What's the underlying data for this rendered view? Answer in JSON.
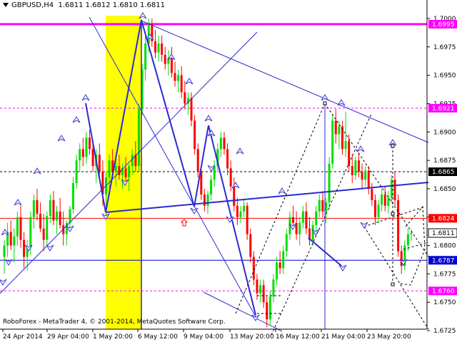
{
  "header": {
    "symbol": "GBPUSD",
    "timeframe": "H4",
    "ohlc": "1.6811 1.6812 1.6810 1.6811"
  },
  "footer": {
    "copyright": "RoboForex - MetaTrader 4, © 2001-2014, MetaQuotes Software Corp."
  },
  "colors": {
    "candle_up": "#00dd00",
    "candle_down": "#ff0000",
    "trend_line": "#2a2ad0",
    "level_magenta": "#ff00ff",
    "level_red": "#ff0000",
    "level_blue": "#0000cc",
    "level_black": "#000000",
    "highlight": "#ffff00",
    "wave_marker": "#3b3bcf",
    "signal_arrow": "#ff0000"
  },
  "chart_data": {
    "type": "candlestick",
    "symbol": "GBPUSD",
    "timeframe": "H4",
    "ylim": [
      1.6715,
      1.7005
    ],
    "y_ticks": [
      "1.7000",
      "1.6975",
      "1.6950",
      "1.6925",
      "1.6900",
      "1.6875",
      "1.6850",
      "1.6825",
      "1.6800",
      "1.6775",
      "1.6750",
      "1.6725"
    ],
    "x_ticks": [
      "24 Apr 2014",
      "29 Apr 04:00",
      "1 May 20:00",
      "6 May 12:00",
      "9 May 04:00",
      "13 May 20:00",
      "16 May 12:00",
      "21 May 04:00",
      "23 May 20:00"
    ],
    "levels": [
      {
        "value": 1.6995,
        "label": "1.6995",
        "color": "#ff00ff",
        "style": "solid"
      },
      {
        "value": 1.6921,
        "label": "1.6921",
        "color": "#ff00ff",
        "style": "dashed"
      },
      {
        "value": 1.6865,
        "label": "1.6865",
        "color": "#000000",
        "style": "dashed"
      },
      {
        "value": 1.6824,
        "label": "1.6824",
        "color": "#ff0000",
        "style": "solid"
      },
      {
        "value": 1.6787,
        "label": "1.6787",
        "color": "#0000cc",
        "style": "solid"
      },
      {
        "value": 1.676,
        "label": "1.6760",
        "color": "#ff00ff",
        "style": "dashed"
      }
    ],
    "current_price": {
      "value": 1.6811,
      "label": "1.6811"
    },
    "candles": [
      {
        "o": 1.679,
        "h": 1.6805,
        "l": 1.6775,
        "c": 1.68
      },
      {
        "o": 1.68,
        "h": 1.682,
        "l": 1.679,
        "c": 1.6812
      },
      {
        "o": 1.6812,
        "h": 1.6822,
        "l": 1.6796,
        "c": 1.68
      },
      {
        "o": 1.68,
        "h": 1.6815,
        "l": 1.6785,
        "c": 1.6808
      },
      {
        "o": 1.6808,
        "h": 1.683,
        "l": 1.68,
        "c": 1.6825
      },
      {
        "o": 1.6825,
        "h": 1.6835,
        "l": 1.6798,
        "c": 1.6805
      },
      {
        "o": 1.6805,
        "h": 1.6812,
        "l": 1.678,
        "c": 1.679
      },
      {
        "o": 1.679,
        "h": 1.6805,
        "l": 1.6778,
        "c": 1.6798
      },
      {
        "o": 1.6798,
        "h": 1.683,
        "l": 1.6792,
        "c": 1.6825
      },
      {
        "o": 1.6825,
        "h": 1.6845,
        "l": 1.6815,
        "c": 1.684
      },
      {
        "o": 1.684,
        "h": 1.685,
        "l": 1.6822,
        "c": 1.6828
      },
      {
        "o": 1.6828,
        "h": 1.6838,
        "l": 1.6812,
        "c": 1.6815
      },
      {
        "o": 1.6815,
        "h": 1.6828,
        "l": 1.6795,
        "c": 1.6805
      },
      {
        "o": 1.6805,
        "h": 1.683,
        "l": 1.68,
        "c": 1.6826
      },
      {
        "o": 1.6826,
        "h": 1.6845,
        "l": 1.682,
        "c": 1.684
      },
      {
        "o": 1.684,
        "h": 1.6848,
        "l": 1.6818,
        "c": 1.6822
      },
      {
        "o": 1.6822,
        "h": 1.6835,
        "l": 1.681,
        "c": 1.683
      },
      {
        "o": 1.683,
        "h": 1.6842,
        "l": 1.6815,
        "c": 1.6818
      },
      {
        "o": 1.6818,
        "h": 1.683,
        "l": 1.68,
        "c": 1.681
      },
      {
        "o": 1.681,
        "h": 1.6822,
        "l": 1.68,
        "c": 1.682
      },
      {
        "o": 1.682,
        "h": 1.6835,
        "l": 1.6815,
        "c": 1.6832
      },
      {
        "o": 1.6832,
        "h": 1.686,
        "l": 1.6828,
        "c": 1.6855
      },
      {
        "o": 1.6855,
        "h": 1.688,
        "l": 1.685,
        "c": 1.6875
      },
      {
        "o": 1.6875,
        "h": 1.689,
        "l": 1.6865,
        "c": 1.6885
      },
      {
        "o": 1.6885,
        "h": 1.6895,
        "l": 1.687,
        "c": 1.6878
      },
      {
        "o": 1.6878,
        "h": 1.69,
        "l": 1.6872,
        "c": 1.6895
      },
      {
        "o": 1.6895,
        "h": 1.6902,
        "l": 1.688,
        "c": 1.6885
      },
      {
        "o": 1.6885,
        "h": 1.6892,
        "l": 1.6865,
        "c": 1.687
      },
      {
        "o": 1.687,
        "h": 1.6885,
        "l": 1.6855,
        "c": 1.688
      },
      {
        "o": 1.688,
        "h": 1.689,
        "l": 1.686,
        "c": 1.6865
      },
      {
        "o": 1.6865,
        "h": 1.6875,
        "l": 1.6835,
        "c": 1.6845
      },
      {
        "o": 1.6845,
        "h": 1.6865,
        "l": 1.6825,
        "c": 1.686
      },
      {
        "o": 1.686,
        "h": 1.688,
        "l": 1.685,
        "c": 1.6875
      },
      {
        "o": 1.6875,
        "h": 1.6885,
        "l": 1.686,
        "c": 1.6865
      },
      {
        "o": 1.6865,
        "h": 1.6878,
        "l": 1.6852,
        "c": 1.687
      },
      {
        "o": 1.687,
        "h": 1.688,
        "l": 1.6858,
        "c": 1.6862
      },
      {
        "o": 1.6862,
        "h": 1.6872,
        "l": 1.685,
        "c": 1.6868
      },
      {
        "o": 1.6868,
        "h": 1.6878,
        "l": 1.6855,
        "c": 1.686
      },
      {
        "o": 1.686,
        "h": 1.6872,
        "l": 1.6848,
        "c": 1.687
      },
      {
        "o": 1.687,
        "h": 1.6885,
        "l": 1.6862,
        "c": 1.688
      },
      {
        "o": 1.688,
        "h": 1.6892,
        "l": 1.6865,
        "c": 1.687
      },
      {
        "o": 1.687,
        "h": 1.6925,
        "l": 1.6865,
        "c": 1.692
      },
      {
        "o": 1.692,
        "h": 1.696,
        "l": 1.6915,
        "c": 1.6955
      },
      {
        "o": 1.6955,
        "h": 1.6985,
        "l": 1.6945,
        "c": 1.6978
      },
      {
        "o": 1.6978,
        "h": 1.7,
        "l": 1.697,
        "c": 1.6995
      },
      {
        "o": 1.6995,
        "h": 1.7,
        "l": 1.6975,
        "c": 1.698
      },
      {
        "o": 1.698,
        "h": 1.699,
        "l": 1.6965,
        "c": 1.697
      },
      {
        "o": 1.697,
        "h": 1.6985,
        "l": 1.6962,
        "c": 1.6978
      },
      {
        "o": 1.6978,
        "h": 1.6985,
        "l": 1.6962,
        "c": 1.6968
      },
      {
        "o": 1.6968,
        "h": 1.6975,
        "l": 1.6955,
        "c": 1.696
      },
      {
        "o": 1.696,
        "h": 1.6972,
        "l": 1.695,
        "c": 1.6965
      },
      {
        "o": 1.6965,
        "h": 1.6975,
        "l": 1.6948,
        "c": 1.6952
      },
      {
        "o": 1.6952,
        "h": 1.6962,
        "l": 1.694,
        "c": 1.6945
      },
      {
        "o": 1.6945,
        "h": 1.6955,
        "l": 1.6935,
        "c": 1.695
      },
      {
        "o": 1.695,
        "h": 1.6958,
        "l": 1.693,
        "c": 1.6935
      },
      {
        "o": 1.6935,
        "h": 1.6945,
        "l": 1.692,
        "c": 1.6925
      },
      {
        "o": 1.6925,
        "h": 1.6935,
        "l": 1.6915,
        "c": 1.693
      },
      {
        "o": 1.693,
        "h": 1.6935,
        "l": 1.6905,
        "c": 1.691
      },
      {
        "o": 1.691,
        "h": 1.6915,
        "l": 1.688,
        "c": 1.6885
      },
      {
        "o": 1.6885,
        "h": 1.689,
        "l": 1.686,
        "c": 1.6865
      },
      {
        "o": 1.6865,
        "h": 1.687,
        "l": 1.684,
        "c": 1.6845
      },
      {
        "o": 1.6845,
        "h": 1.685,
        "l": 1.683,
        "c": 1.6835
      },
      {
        "o": 1.6835,
        "h": 1.6848,
        "l": 1.6828,
        "c": 1.6845
      },
      {
        "o": 1.6845,
        "h": 1.6862,
        "l": 1.684,
        "c": 1.6858
      },
      {
        "o": 1.6858,
        "h": 1.6875,
        "l": 1.6852,
        "c": 1.687
      },
      {
        "o": 1.687,
        "h": 1.689,
        "l": 1.6865,
        "c": 1.6885
      },
      {
        "o": 1.6885,
        "h": 1.69,
        "l": 1.6878,
        "c": 1.6895
      },
      {
        "o": 1.6895,
        "h": 1.69,
        "l": 1.688,
        "c": 1.6885
      },
      {
        "o": 1.6885,
        "h": 1.689,
        "l": 1.6862,
        "c": 1.6868
      },
      {
        "o": 1.6868,
        "h": 1.6875,
        "l": 1.6848,
        "c": 1.6852
      },
      {
        "o": 1.6852,
        "h": 1.686,
        "l": 1.683,
        "c": 1.6835
      },
      {
        "o": 1.6835,
        "h": 1.6842,
        "l": 1.6818,
        "c": 1.6825
      },
      {
        "o": 1.6825,
        "h": 1.6835,
        "l": 1.682,
        "c": 1.683
      },
      {
        "o": 1.683,
        "h": 1.684,
        "l": 1.6825,
        "c": 1.6835
      },
      {
        "o": 1.6835,
        "h": 1.6838,
        "l": 1.6805,
        "c": 1.681
      },
      {
        "o": 1.681,
        "h": 1.6815,
        "l": 1.6785,
        "c": 1.679
      },
      {
        "o": 1.679,
        "h": 1.6795,
        "l": 1.6765,
        "c": 1.677
      },
      {
        "o": 1.677,
        "h": 1.6775,
        "l": 1.6752,
        "c": 1.6758
      },
      {
        "o": 1.6758,
        "h": 1.677,
        "l": 1.675,
        "c": 1.6765
      },
      {
        "o": 1.6765,
        "h": 1.677,
        "l": 1.6745,
        "c": 1.675
      },
      {
        "o": 1.675,
        "h": 1.6755,
        "l": 1.6728,
        "c": 1.6735
      },
      {
        "o": 1.6735,
        "h": 1.676,
        "l": 1.673,
        "c": 1.6755
      },
      {
        "o": 1.6755,
        "h": 1.6775,
        "l": 1.675,
        "c": 1.677
      },
      {
        "o": 1.677,
        "h": 1.679,
        "l": 1.6765,
        "c": 1.6785
      },
      {
        "o": 1.6785,
        "h": 1.6795,
        "l": 1.6775,
        "c": 1.678
      },
      {
        "o": 1.678,
        "h": 1.68,
        "l": 1.6775,
        "c": 1.6795
      },
      {
        "o": 1.6795,
        "h": 1.6815,
        "l": 1.679,
        "c": 1.681
      },
      {
        "o": 1.681,
        "h": 1.683,
        "l": 1.6805,
        "c": 1.6825
      },
      {
        "o": 1.6825,
        "h": 1.6835,
        "l": 1.6815,
        "c": 1.682
      },
      {
        "o": 1.682,
        "h": 1.683,
        "l": 1.6805,
        "c": 1.681
      },
      {
        "o": 1.681,
        "h": 1.6825,
        "l": 1.68,
        "c": 1.682
      },
      {
        "o": 1.682,
        "h": 1.6835,
        "l": 1.6815,
        "c": 1.683
      },
      {
        "o": 1.683,
        "h": 1.6838,
        "l": 1.681,
        "c": 1.6815
      },
      {
        "o": 1.6815,
        "h": 1.6825,
        "l": 1.68,
        "c": 1.6805
      },
      {
        "o": 1.6805,
        "h": 1.6822,
        "l": 1.68,
        "c": 1.6818
      },
      {
        "o": 1.6818,
        "h": 1.6835,
        "l": 1.6812,
        "c": 1.683
      },
      {
        "o": 1.683,
        "h": 1.6845,
        "l": 1.6825,
        "c": 1.684
      },
      {
        "o": 1.684,
        "h": 1.6848,
        "l": 1.6825,
        "c": 1.683
      },
      {
        "o": 1.683,
        "h": 1.6842,
        "l": 1.682,
        "c": 1.6838
      },
      {
        "o": 1.6838,
        "h": 1.6878,
        "l": 1.6832,
        "c": 1.6872
      },
      {
        "o": 1.6872,
        "h": 1.6915,
        "l": 1.6868,
        "c": 1.691
      },
      {
        "o": 1.691,
        "h": 1.692,
        "l": 1.689,
        "c": 1.6898
      },
      {
        "o": 1.6898,
        "h": 1.691,
        "l": 1.6885,
        "c": 1.6905
      },
      {
        "o": 1.6905,
        "h": 1.691,
        "l": 1.688,
        "c": 1.6885
      },
      {
        "o": 1.6885,
        "h": 1.6918,
        "l": 1.6878,
        "c": 1.6892
      },
      {
        "o": 1.6892,
        "h": 1.6898,
        "l": 1.6865,
        "c": 1.687
      },
      {
        "o": 1.687,
        "h": 1.688,
        "l": 1.6855,
        "c": 1.6862
      },
      {
        "o": 1.6862,
        "h": 1.6878,
        "l": 1.6858,
        "c": 1.6875
      },
      {
        "o": 1.6875,
        "h": 1.6882,
        "l": 1.686,
        "c": 1.6865
      },
      {
        "o": 1.6865,
        "h": 1.6872,
        "l": 1.685,
        "c": 1.6858
      },
      {
        "o": 1.6858,
        "h": 1.687,
        "l": 1.6852,
        "c": 1.6866
      },
      {
        "o": 1.6866,
        "h": 1.687,
        "l": 1.6845,
        "c": 1.685
      },
      {
        "o": 1.685,
        "h": 1.6855,
        "l": 1.6835,
        "c": 1.684
      },
      {
        "o": 1.684,
        "h": 1.6845,
        "l": 1.6818,
        "c": 1.6825
      },
      {
        "o": 1.6825,
        "h": 1.684,
        "l": 1.682,
        "c": 1.6836
      },
      {
        "o": 1.6836,
        "h": 1.685,
        "l": 1.683,
        "c": 1.6845
      },
      {
        "o": 1.6845,
        "h": 1.6852,
        "l": 1.683,
        "c": 1.6835
      },
      {
        "o": 1.6835,
        "h": 1.6848,
        "l": 1.6828,
        "c": 1.6842
      },
      {
        "o": 1.6842,
        "h": 1.6862,
        "l": 1.6838,
        "c": 1.6858
      },
      {
        "o": 1.6858,
        "h": 1.6865,
        "l": 1.6835,
        "c": 1.684
      },
      {
        "o": 1.684,
        "h": 1.6845,
        "l": 1.679,
        "c": 1.6795
      },
      {
        "o": 1.6795,
        "h": 1.68,
        "l": 1.6775,
        "c": 1.6782
      },
      {
        "o": 1.6782,
        "h": 1.6805,
        "l": 1.6778,
        "c": 1.68
      },
      {
        "o": 1.68,
        "h": 1.6815,
        "l": 1.6795,
        "c": 1.681
      },
      {
        "o": 1.681,
        "h": 1.6814,
        "l": 1.6804,
        "c": 1.6811
      }
    ]
  }
}
